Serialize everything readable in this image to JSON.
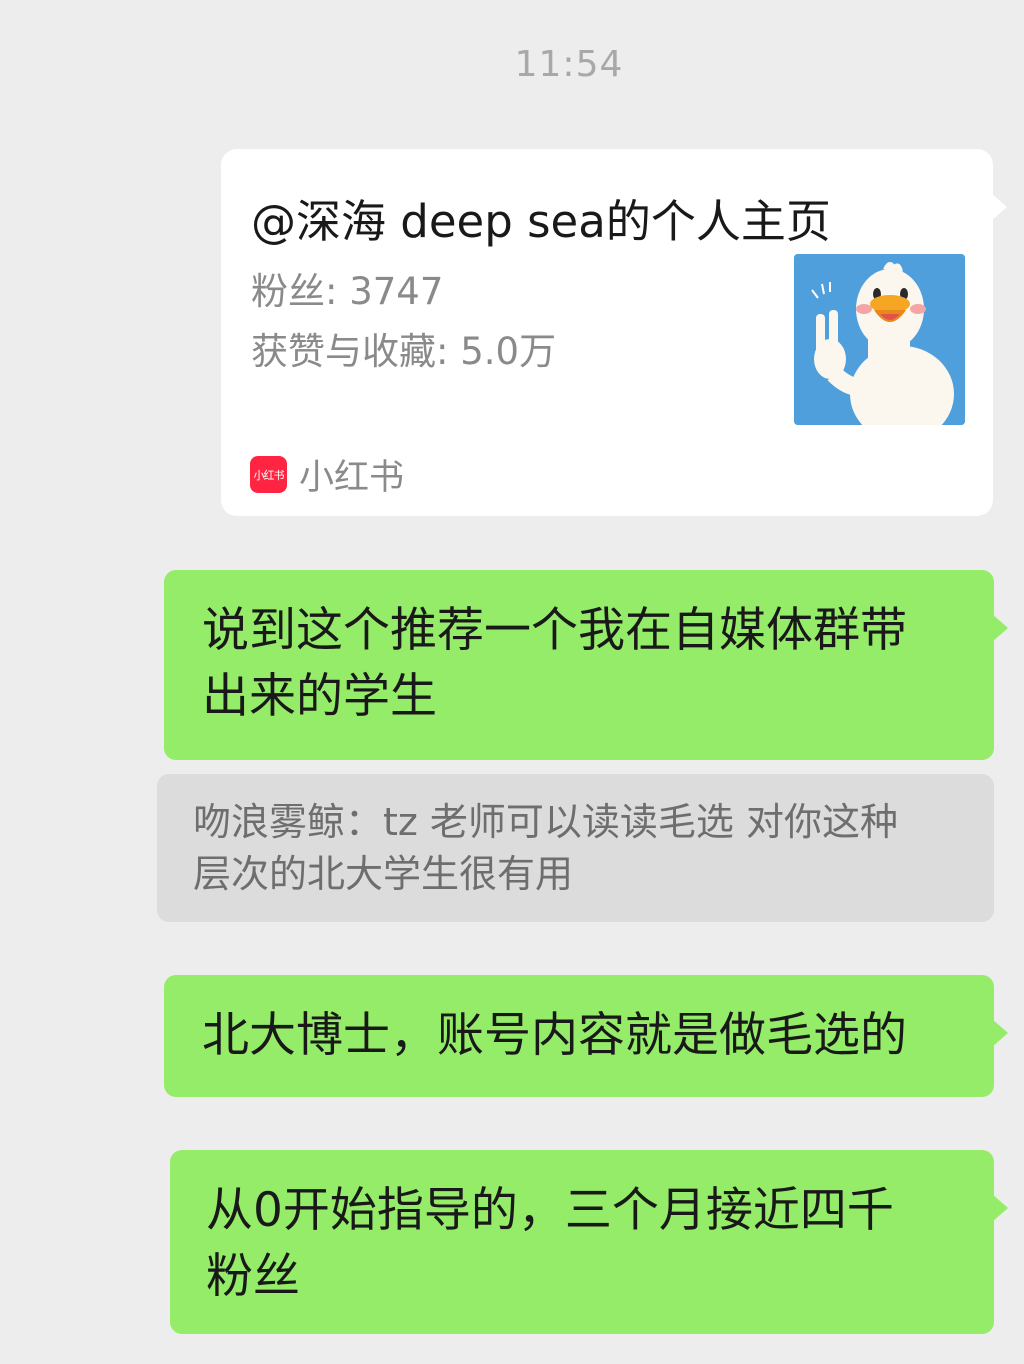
{
  "timestamp": "11:54",
  "card": {
    "title": "@深海 deep sea的个人主页",
    "fans": "粉丝: 3747",
    "likes": "获赞与收藏: 5.0万",
    "app_icon_text": "小红书",
    "app_name": "小红书",
    "thumbnail_icon": "duck-peace-sign-avatar"
  },
  "messages": [
    {
      "text": "说到这个推荐一个我在自媒体群带\n出来的学生"
    },
    {
      "text": "北大博士，账号内容就是做毛选的"
    },
    {
      "text": "从0开始指导的，三个月接近四千\n粉丝"
    }
  ],
  "quote": {
    "text": "吻浪雾鲸：tz 老师可以读读毛选 对你这种\n层次的北大学生很有用"
  },
  "colors": {
    "background": "#ededed",
    "bubble_green": "#95ec69",
    "card_white": "#ffffff",
    "quote_gray": "#dcdcdc",
    "xiaohongshu_red": "#ff2442"
  }
}
